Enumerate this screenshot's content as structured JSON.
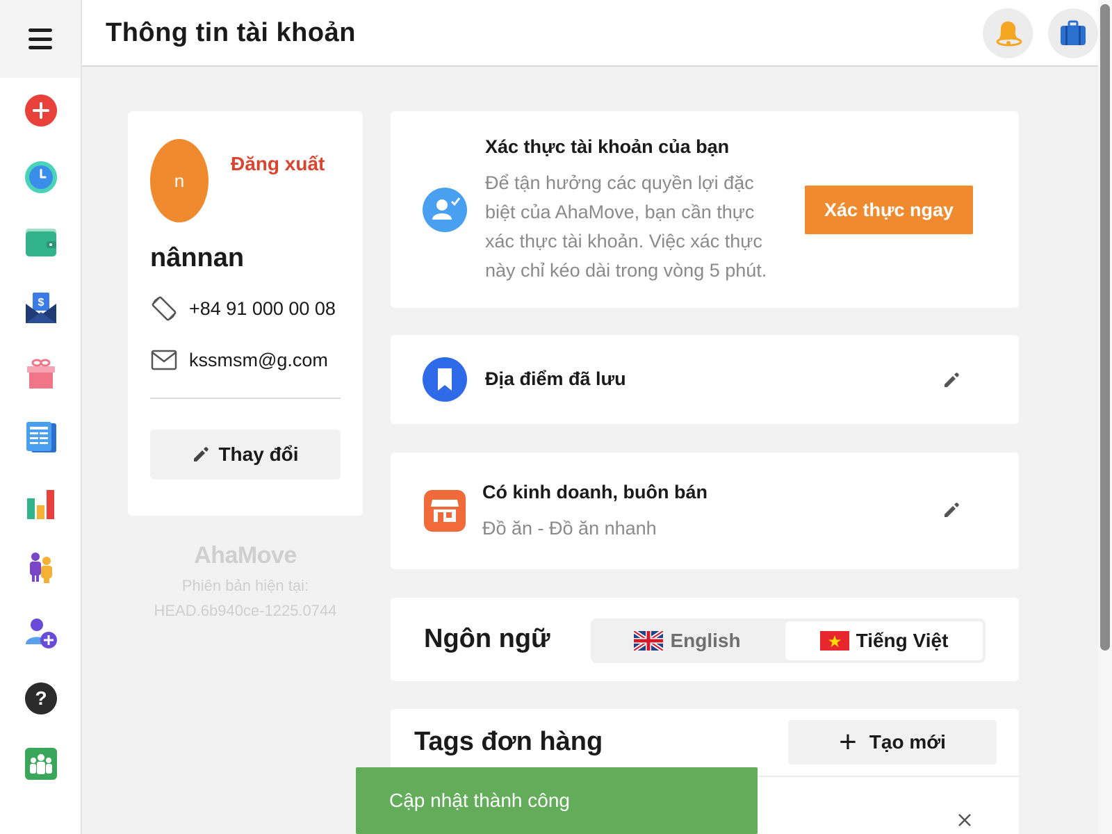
{
  "header": {
    "title": "Thông tin tài khoản",
    "notification_icon": "bell-icon",
    "briefcase_icon": "briefcase-icon"
  },
  "sidebar": {
    "menu_icon": "hamburger-menu-icon",
    "items": [
      {
        "icon": "add-order-icon",
        "color": "#e8413b"
      },
      {
        "icon": "clock-icon",
        "color": "#3aa1e8"
      },
      {
        "icon": "wallet-icon",
        "color": "#33b38a"
      },
      {
        "icon": "money-envelope-icon",
        "color": "#2a4a8f"
      },
      {
        "icon": "gift-icon",
        "color": "#f07587"
      },
      {
        "icon": "document-list-icon",
        "color": "#3b8ee8"
      },
      {
        "icon": "bar-chart-icon",
        "color": "#e8413b"
      },
      {
        "icon": "people-icon",
        "color": "#7a45c9"
      },
      {
        "icon": "add-user-icon",
        "color": "#6a4ad9"
      },
      {
        "icon": "help-icon",
        "color": "#2b2b2b"
      },
      {
        "icon": "group-icon",
        "color": "#3aa65a"
      }
    ]
  },
  "profile": {
    "avatar_letter": "n",
    "logout_label": "Đăng xuất",
    "name": "nânnan",
    "phone": "+84 91 000 00 08",
    "email": "kssmsm@g.com",
    "edit_label": "Thay đổi",
    "brand": "AhaMove",
    "version_label": "Phiên bản hiện tại:",
    "version": "HEAD.6b940ce-1225.0744"
  },
  "verify": {
    "title": "Xác thực tài khoản của bạn",
    "description": "Để tận hưởng các quyền lợi đặc biệt của AhaMove, bạn cần thực xác thực tài khoản. Việc xác thực này chỉ kéo dài trong vòng 5 phút.",
    "button_label": "Xác thực ngay"
  },
  "saved_places": {
    "label": "Địa điểm đã lưu"
  },
  "business": {
    "title": "Có kinh doanh, buôn bán",
    "category": "Đồ ăn - Đồ ăn nhanh"
  },
  "language": {
    "label": "Ngôn ngữ",
    "options": [
      "English",
      "Tiếng Việt"
    ],
    "selected": "Tiếng Việt"
  },
  "tags": {
    "title": "Tags đơn hàng",
    "new_label": "Tạo mới"
  },
  "toast": {
    "message": "Cập nhật thành công",
    "color": "#63ad5a"
  },
  "colors": {
    "accent": "#f08a2f",
    "logout": "#d9452f"
  }
}
